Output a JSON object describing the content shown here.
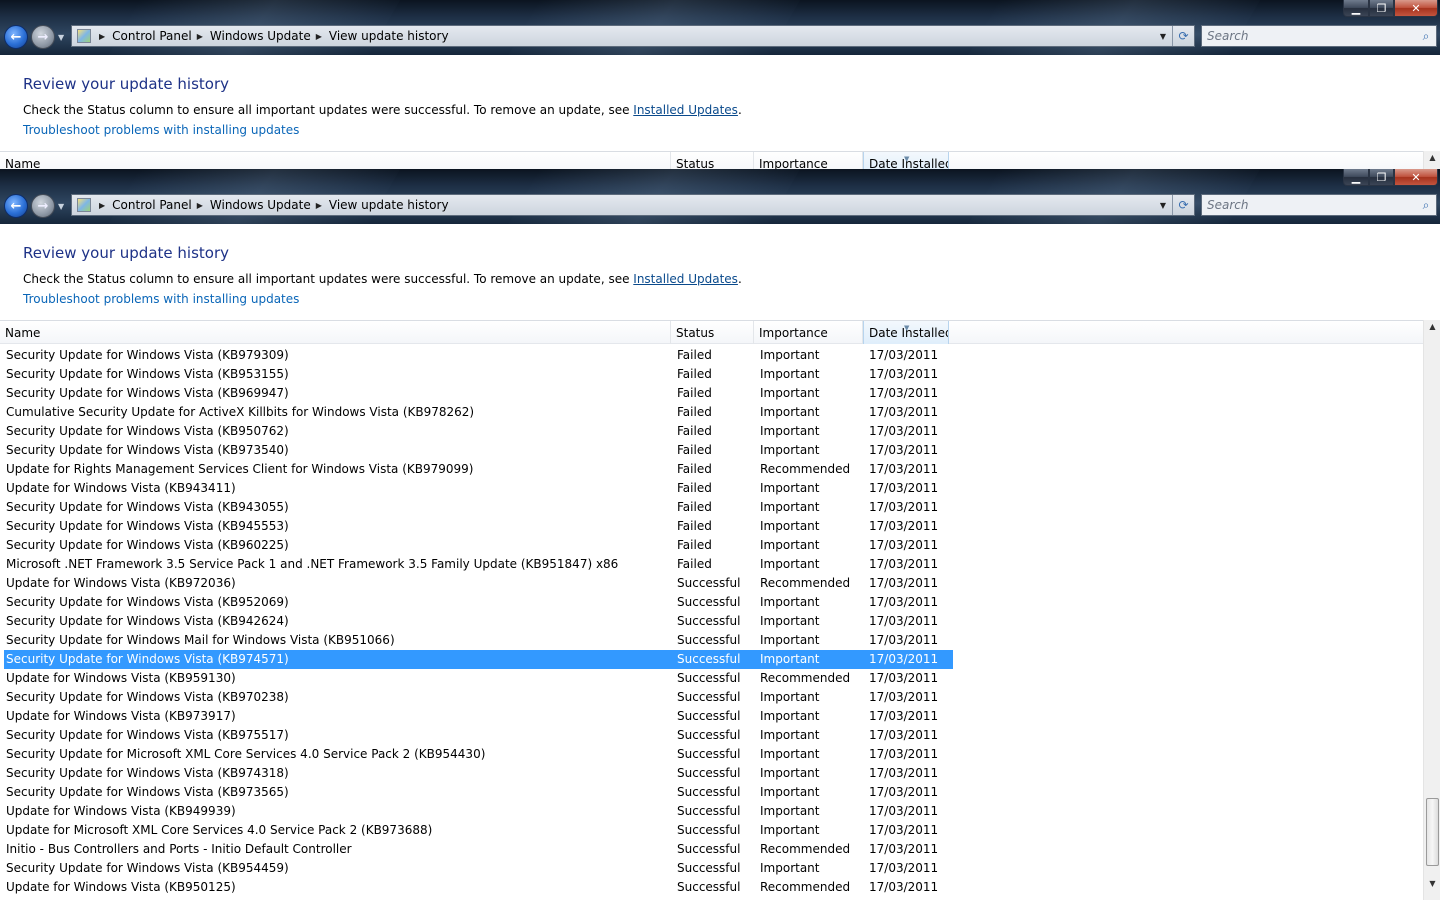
{
  "address": {
    "crumbs": [
      "Control Panel",
      "Windows Update",
      "View update history"
    ]
  },
  "search": {
    "placeholder": "Search"
  },
  "page": {
    "heading": "Review your update history",
    "desc_prefix": "Check the Status column to ensure all important updates were successful. To remove an update, see ",
    "desc_link": "Installed Updates",
    "desc_suffix": ".",
    "troubleshoot": "Troubleshoot problems with installing updates"
  },
  "columns": {
    "name": "Name",
    "status": "Status",
    "importance": "Importance",
    "date": "Date Installed"
  },
  "selected_index": 16,
  "rows": [
    {
      "name": "Security Update for Windows Vista (KB979309)",
      "status": "Failed",
      "importance": "Important",
      "date": "17/03/2011"
    },
    {
      "name": "Security Update for Windows Vista (KB953155)",
      "status": "Failed",
      "importance": "Important",
      "date": "17/03/2011"
    },
    {
      "name": "Security Update for Windows Vista (KB969947)",
      "status": "Failed",
      "importance": "Important",
      "date": "17/03/2011"
    },
    {
      "name": "Cumulative Security Update for ActiveX Killbits for Windows Vista (KB978262)",
      "status": "Failed",
      "importance": "Important",
      "date": "17/03/2011"
    },
    {
      "name": "Security Update for Windows Vista (KB950762)",
      "status": "Failed",
      "importance": "Important",
      "date": "17/03/2011"
    },
    {
      "name": "Security Update for Windows Vista (KB973540)",
      "status": "Failed",
      "importance": "Important",
      "date": "17/03/2011"
    },
    {
      "name": "Update for Rights Management Services Client for Windows Vista (KB979099)",
      "status": "Failed",
      "importance": "Recommended",
      "date": "17/03/2011"
    },
    {
      "name": "Update for Windows Vista (KB943411)",
      "status": "Failed",
      "importance": "Important",
      "date": "17/03/2011"
    },
    {
      "name": "Security Update for Windows Vista (KB943055)",
      "status": "Failed",
      "importance": "Important",
      "date": "17/03/2011"
    },
    {
      "name": "Security Update for Windows Vista (KB945553)",
      "status": "Failed",
      "importance": "Important",
      "date": "17/03/2011"
    },
    {
      "name": "Security Update for Windows Vista (KB960225)",
      "status": "Failed",
      "importance": "Important",
      "date": "17/03/2011"
    },
    {
      "name": "Microsoft .NET Framework 3.5 Service Pack 1 and .NET Framework 3.5 Family Update (KB951847) x86",
      "status": "Failed",
      "importance": "Important",
      "date": "17/03/2011"
    },
    {
      "name": "Update for Windows Vista (KB972036)",
      "status": "Successful",
      "importance": "Recommended",
      "date": "17/03/2011"
    },
    {
      "name": "Security Update for Windows Vista (KB952069)",
      "status": "Successful",
      "importance": "Important",
      "date": "17/03/2011"
    },
    {
      "name": "Security Update for Windows Vista (KB942624)",
      "status": "Successful",
      "importance": "Important",
      "date": "17/03/2011"
    },
    {
      "name": "Security Update for Windows Mail for Windows Vista (KB951066)",
      "status": "Successful",
      "importance": "Important",
      "date": "17/03/2011"
    },
    {
      "name": "Security Update for Windows Vista (KB974571)",
      "status": "Successful",
      "importance": "Important",
      "date": "17/03/2011"
    },
    {
      "name": "Update for Windows Vista (KB959130)",
      "status": "Successful",
      "importance": "Recommended",
      "date": "17/03/2011"
    },
    {
      "name": "Security Update for Windows Vista (KB970238)",
      "status": "Successful",
      "importance": "Important",
      "date": "17/03/2011"
    },
    {
      "name": "Update for Windows Vista (KB973917)",
      "status": "Successful",
      "importance": "Important",
      "date": "17/03/2011"
    },
    {
      "name": "Security Update for Windows Vista (KB975517)",
      "status": "Successful",
      "importance": "Important",
      "date": "17/03/2011"
    },
    {
      "name": "Security Update for Microsoft XML Core Services 4.0 Service Pack 2 (KB954430)",
      "status": "Successful",
      "importance": "Important",
      "date": "17/03/2011"
    },
    {
      "name": "Security Update for Windows Vista (KB974318)",
      "status": "Successful",
      "importance": "Important",
      "date": "17/03/2011"
    },
    {
      "name": "Security Update for Windows Vista (KB973565)",
      "status": "Successful",
      "importance": "Important",
      "date": "17/03/2011"
    },
    {
      "name": "Update for Windows Vista (KB949939)",
      "status": "Successful",
      "importance": "Important",
      "date": "17/03/2011"
    },
    {
      "name": "Update for Microsoft XML Core Services 4.0 Service Pack 2 (KB973688)",
      "status": "Successful",
      "importance": "Important",
      "date": "17/03/2011"
    },
    {
      "name": "Initio - Bus Controllers and Ports - Initio Default Controller",
      "status": "Successful",
      "importance": "Recommended",
      "date": "17/03/2011"
    },
    {
      "name": "Security Update for Windows Vista (KB954459)",
      "status": "Successful",
      "importance": "Important",
      "date": "17/03/2011"
    },
    {
      "name": "Update for Windows Vista (KB950125)",
      "status": "Successful",
      "importance": "Recommended",
      "date": "17/03/2011"
    }
  ],
  "icons": {
    "minimize": "minimize-icon",
    "maximize": "maximize-icon",
    "close": "close-icon",
    "back": "back-arrow-icon",
    "forward": "forward-arrow-icon",
    "refresh": "refresh-icon",
    "search": "search-icon",
    "control_panel": "control-panel-icon"
  },
  "colors": {
    "heading": "#1e3287",
    "link": "#0a4a8c",
    "selection": "#3399ff"
  }
}
